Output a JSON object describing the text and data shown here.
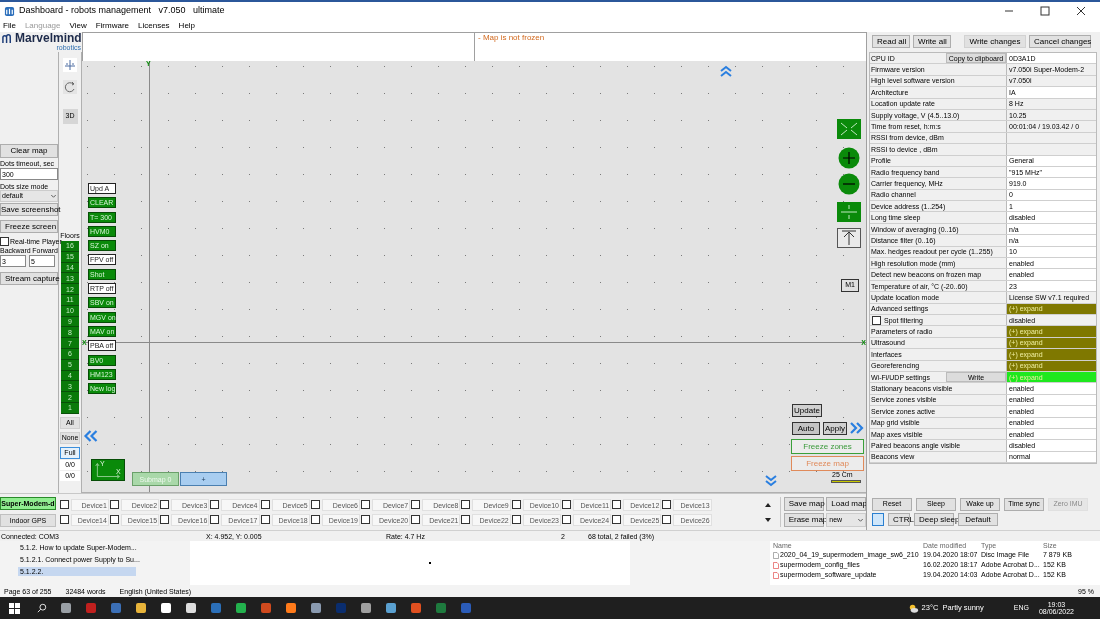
{
  "window": {
    "title": "Dashboard - robots management   v7.050   ultimate"
  },
  "menu": [
    {
      "label": "File",
      "disabled": false
    },
    {
      "label": "Language",
      "disabled": true
    },
    {
      "label": "View",
      "disabled": false
    },
    {
      "label": "Firmware",
      "disabled": false
    },
    {
      "label": "Licenses",
      "disabled": false
    },
    {
      "label": "Help",
      "disabled": false
    }
  ],
  "logo": {
    "name": "Marvelmind",
    "tagline": "robotics"
  },
  "left_panel": {
    "clear_map": "Clear map",
    "dots_timeout": {
      "label": "Dots timeout, sec",
      "value": "300"
    },
    "dots_size": {
      "label": "Dots size mode",
      "value": "default"
    },
    "save_screenshot": "Save screenshot",
    "freeze_screen": "Freeze screen",
    "realtime": {
      "label": "Real-time Player",
      "checked": false
    },
    "backward": {
      "label": "Backward",
      "value": "3"
    },
    "forward": {
      "label": "Forward",
      "value": "5"
    },
    "stream_capture": "Stream capture"
  },
  "tools": {
    "view_3d": "3D"
  },
  "floors": {
    "label": "Floors",
    "items": [
      "16",
      "15",
      "14",
      "13",
      "12",
      "11",
      "10",
      "9",
      "8",
      "7",
      "6",
      "5",
      "4",
      "3",
      "2",
      "1"
    ],
    "buttons": [
      {
        "label": "All",
        "selected": false
      },
      {
        "label": "None",
        "selected": false
      },
      {
        "label": "Full",
        "selected": true
      }
    ],
    "counters": [
      "0/0",
      "0/0"
    ]
  },
  "map": {
    "status": "- Map is not frozen",
    "axis_x": "X",
    "axis_x_right": "X",
    "axis_y": "Y",
    "buttons": [
      {
        "label": "Upd A",
        "on": false
      },
      {
        "label": "CLEAR",
        "on": true
      },
      {
        "label": "T= 300",
        "on": true
      },
      {
        "label": "HVM0",
        "on": true
      },
      {
        "label": "SZ on",
        "on": true
      },
      {
        "label": "FPV off",
        "on": false
      },
      {
        "label": "Shot",
        "on": true
      },
      {
        "label": "RTP off",
        "on": false
      },
      {
        "label": "SBV on",
        "on": true
      },
      {
        "label": "MGV on",
        "on": true
      },
      {
        "label": "MAV on",
        "on": true
      },
      {
        "label": "PBA off",
        "on": false
      },
      {
        "label": "BV0",
        "on": true
      },
      {
        "label": "HM123",
        "on": true
      },
      {
        "label": "New log",
        "on": true
      }
    ],
    "m1": "M1",
    "update": "Update",
    "auto": "Auto",
    "apply": "Apply",
    "freeze_zones": "Freeze zones",
    "freeze_map": "Freeze map",
    "scale": "25 Cm",
    "axes_widget": {
      "y": "Y",
      "x": "X"
    },
    "submaps": [
      {
        "label": "Submap 0",
        "kind": "submap"
      },
      {
        "label": "+",
        "kind": "add"
      }
    ]
  },
  "modems": [
    {
      "label": "Super-Modem-d",
      "selected": true
    },
    {
      "label": "Indoor GPS",
      "selected": false
    }
  ],
  "devices": [
    {
      "label": "Device1",
      "checked": false
    },
    {
      "label": "Device2",
      "checked": false
    },
    {
      "label": "Device3",
      "checked": false
    },
    {
      "label": "Device4",
      "checked": false
    },
    {
      "label": "Device5",
      "checked": false
    },
    {
      "label": "Device6",
      "checked": false
    },
    {
      "label": "Device7",
      "checked": false
    },
    {
      "label": "Device8",
      "checked": false
    },
    {
      "label": "Device9",
      "checked": false
    },
    {
      "label": "Device10",
      "checked": false
    },
    {
      "label": "Device11",
      "checked": false
    },
    {
      "label": "Device12",
      "checked": false
    },
    {
      "label": "Device13",
      "checked": false
    },
    {
      "label": "Device14",
      "checked": false
    },
    {
      "label": "Device15",
      "checked": false
    },
    {
      "label": "Device16",
      "checked": false
    },
    {
      "label": "Device17",
      "checked": false
    },
    {
      "label": "Device18",
      "checked": false
    },
    {
      "label": "Device19",
      "checked": false
    },
    {
      "label": "Device20",
      "checked": false
    },
    {
      "label": "Device21",
      "checked": false
    },
    {
      "label": "Device22",
      "checked": false
    },
    {
      "label": "Device23",
      "checked": false
    },
    {
      "label": "Device24",
      "checked": false
    },
    {
      "label": "Device25",
      "checked": false
    },
    {
      "label": "Device26",
      "checked": false
    }
  ],
  "map_files": {
    "save": "Save map",
    "load": "Load map",
    "erase": "Erase map",
    "select": "new"
  },
  "status_bar": [
    "Connected: COM3",
    "X: 4.952, Y: 0.005",
    "Rate: 4.7 Hz",
    "2",
    "68 total, 2 failed (3%)"
  ],
  "settings": {
    "top_buttons": [
      "Read all",
      "Write all",
      "Write changes",
      "Cancel changes"
    ],
    "rows": [
      {
        "label": "CPU ID",
        "button": "Copy to clipboard",
        "value": "0D3A1D",
        "editable": true
      },
      {
        "label": "Firmware version",
        "value": "v7.050i Super-Modem-2",
        "editable": false
      },
      {
        "label": "High level software version",
        "value": "v7.050i",
        "editable": false
      },
      {
        "label": "Architecture",
        "value": "IA",
        "editable": true
      },
      {
        "label": "Location update rate",
        "value": "8 Hz",
        "editable": false
      },
      {
        "label": "Supply voltage, V (4.5..13.0)",
        "value": "10.25",
        "editable": false
      },
      {
        "label": "Time from reset, h:m:s",
        "value": "00:01:04 / 19.03.42 / 0",
        "editable": false
      },
      {
        "label": "RSSI from device, dBm",
        "editable": false
      },
      {
        "label": "RSSI to device , dBm",
        "editable": false
      },
      {
        "label": "Profile",
        "value": "General",
        "editable": true
      },
      {
        "label": "Radio frequency band",
        "value": "\"915 MHz\"",
        "editable": true
      },
      {
        "label": "Carrier frequency, MHz",
        "value": "919.0",
        "editable": true
      },
      {
        "label": "Radio channel",
        "value": "0",
        "editable": true
      },
      {
        "label": "Device address (1..254)",
        "value": "1",
        "editable": true
      },
      {
        "label": "Long time sleep",
        "value": "disabled",
        "editable": true
      },
      {
        "label": "Window of averaging (0..16)",
        "value": "n/a",
        "editable": true
      },
      {
        "label": "Distance filter (0..16)",
        "value": "n/a",
        "editable": true
      },
      {
        "label": "Max. hedges readout per cycle (1..255)",
        "value": "10",
        "editable": true
      },
      {
        "label": "High resolution mode (mm)",
        "value": "enabled",
        "editable": true
      },
      {
        "label": "Detect new beacons on frozen map",
        "value": "enabled",
        "editable": true
      },
      {
        "label": "Temperature of air, °C (-20..60)",
        "value": "23",
        "editable": true
      },
      {
        "label": "Update location mode",
        "value": "License SW v7.1 required",
        "editable": false
      },
      {
        "label": "Advanced settings",
        "value": "(+) expand",
        "color": "#7f7800"
      },
      {
        "label": "Spot filtering",
        "checked": false,
        "value": "disabled",
        "editable": false
      },
      {
        "label": "Parameters of radio",
        "value": "(+) expand",
        "color": "#7f7800"
      },
      {
        "label": "Ultrasound",
        "value": "(+) expand",
        "color": "#7f7800"
      },
      {
        "label": "Interfaces",
        "value": "(+) expand",
        "color": "#7f7800"
      },
      {
        "label": "Georeferencing",
        "value": "(+) expand",
        "color": "#7f7800"
      },
      {
        "label": "Wi-Fi/UDP settings",
        "button": "Write",
        "value": "(+) expand",
        "color": "#1ee81e"
      },
      {
        "label": "Stationary beacons visible",
        "value": "enabled",
        "editable": true
      },
      {
        "label": "Service zones visible",
        "value": "enabled",
        "editable": true
      },
      {
        "label": "Service zones active",
        "value": "enabled",
        "editable": true
      },
      {
        "label": "Map grid visible",
        "value": "enabled",
        "editable": true
      },
      {
        "label": "Map axes visible",
        "value": "enabled",
        "editable": true
      },
      {
        "label": "Paired beacons angle visible",
        "value": "disabled",
        "editable": true
      },
      {
        "label": "Beacons view",
        "value": "normal",
        "editable": true
      }
    ],
    "bottom_buttons": [
      {
        "label": "Reset",
        "disabled": false
      },
      {
        "label": "Sleep",
        "disabled": false
      },
      {
        "label": "Wake up",
        "disabled": false
      },
      {
        "label": "Time sync",
        "disabled": false
      },
      {
        "label": "Zero IMU",
        "disabled": true
      }
    ],
    "bottom_buttons_2": [
      "CTRL",
      "Deep sleep",
      "Default"
    ]
  },
  "document": {
    "outline": [
      {
        "label": "5.1.2. How to update Super-Modem...",
        "selected": false
      },
      {
        "label": "5.1.2.1. Connect power Supply to Su...",
        "selected": false
      },
      {
        "label": "5.1.2.2.",
        "selected": true
      }
    ],
    "status": [
      "Page 63 of 255",
      "32484 words",
      "English (United States)"
    ],
    "zoom": "95 %"
  },
  "files": {
    "columns": [
      "Name",
      "Date modified",
      "Type",
      "Size"
    ],
    "rows": [
      [
        "2020_04_19_supermodem_image_sw6_210",
        "19.04.2020 18:07",
        "Disc Image File",
        "7 879 KB"
      ],
      [
        "supermodem_config_files",
        "16.02.2020 18:17",
        "Adobe Acrobat D...",
        "152 KB"
      ],
      [
        "supermodem_software_update",
        "19.04.2020 14:03",
        "Adobe Acrobat D...",
        "152 KB"
      ]
    ]
  },
  "taskbar": {
    "weather": "23°C  Partly sunny",
    "language": "ENG",
    "time": "19:03",
    "date": "08/06/2022"
  }
}
